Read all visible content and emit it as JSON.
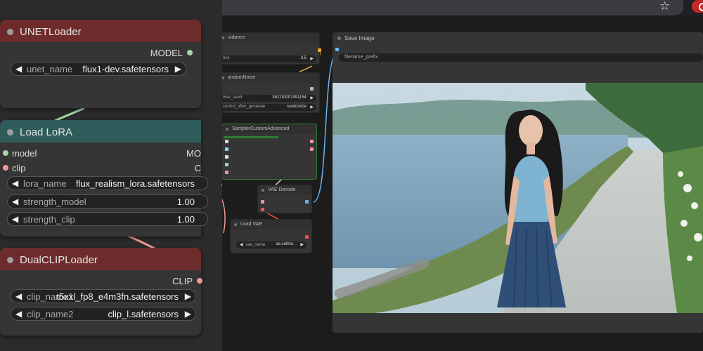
{
  "browser": {
    "star_icon": "star-icon",
    "extension_icon": "record-icon",
    "extension_color": "#c62828"
  },
  "nodes": {
    "unet_loader": {
      "title": "UNETLoader",
      "header_color": "#6e2b2b",
      "output": "MODEL",
      "widget_label": "unet_name",
      "widget_value": "flux1-dev.safetensors"
    },
    "load_lora": {
      "title": "Load LoRA",
      "header_color": "#2f5b5b",
      "inputs": [
        "model",
        "clip"
      ],
      "output_partial": "MO",
      "output_partial2": "C",
      "widgets": [
        {
          "label": "lora_name",
          "value": "flux_realism_lora.safetensors"
        },
        {
          "label": "strength_model",
          "value": "1.00"
        },
        {
          "label": "strength_clip",
          "value": "1.00"
        }
      ]
    },
    "dual_clip_loader": {
      "title": "DualCLIPLoader",
      "header_color": "#6e2b2b",
      "output": "CLIP",
      "widgets": [
        {
          "label": "clip_name1",
          "value": "t5xxl_fp8_e4m3fn.safetensors"
        },
        {
          "label": "clip_name2",
          "value": "clip_l.safetensors"
        }
      ]
    },
    "guidance": {
      "title": "uidance",
      "widget_label": "nce",
      "widget_value": "3.5"
    },
    "random_noise": {
      "title": "andomNoise",
      "widgets": [
        {
          "label": "oise_seed",
          "value": "361110007491154"
        },
        {
          "label": "control_after_generate",
          "value": "randomize"
        }
      ]
    },
    "sampler": {
      "title": "SamplerCustomAdvanced"
    },
    "vae_decode": {
      "title": "VAE Decode"
    },
    "load_vae": {
      "title": "Load VAE",
      "widget_label": "vae_name",
      "widget_value": "ae.safete..."
    },
    "save_image": {
      "title": "Save Image",
      "widget_label": "filename_prefix"
    }
  },
  "colors": {
    "model_pin": "#a5d6a7",
    "clip_pin": "#ef9a9a",
    "vae_pin": "#f48fb1",
    "latent_pin": "#f8bbd0",
    "image_pin": "#64b5f6",
    "sampler_progress": "#2e7d32"
  }
}
